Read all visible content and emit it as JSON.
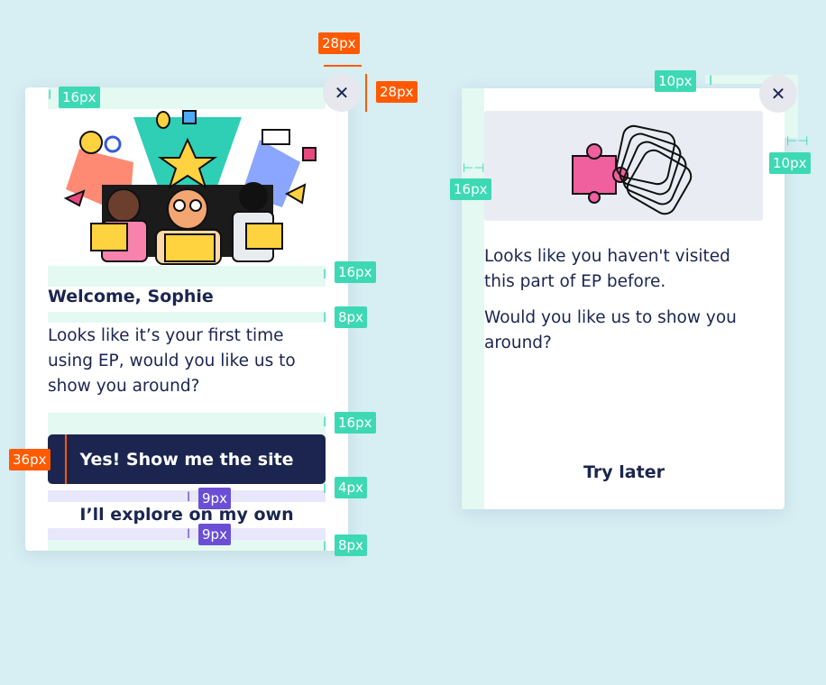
{
  "welcome_card": {
    "close_symbol": "✕",
    "title": "Welcome, Sophie",
    "body": "Looks like it’s your first time using EP, would you like us to show you around?",
    "primary_button": "Yes! Show me the site",
    "secondary_button": "I’ll explore on my own"
  },
  "revisit_card": {
    "close_symbol": "✕",
    "body_1": "Looks like you haven't visited this part of EP before.",
    "body_2": "Would you like us to show you around?",
    "secondary_button": "Try later"
  },
  "spec_labels": {
    "s16a": "16px",
    "s28w": "28px",
    "s28h": "28px",
    "s16b": "16px",
    "s8a": "8px",
    "s16c": "16px",
    "s36": "36px",
    "s4": "4px",
    "s9a": "9px",
    "s9b": "9px",
    "s8b": "8px",
    "s10a": "10px",
    "s10b": "10px",
    "s16d": "16px"
  },
  "colors": {
    "navy": "#1b2550",
    "mint": "#3dd9b4",
    "orange": "#ff5a00",
    "purple": "#6a4fd6",
    "background": "#d7eef3"
  }
}
